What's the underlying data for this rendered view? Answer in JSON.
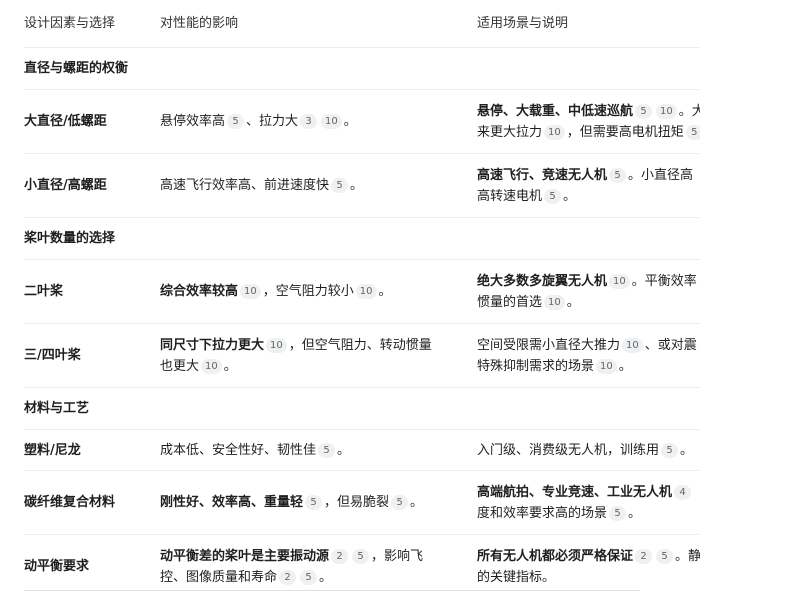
{
  "header": {
    "col1": "设计因素与选择",
    "col2": "对性能的影响",
    "col3": "适用场景与说明"
  },
  "sections": {
    "s1": "直径与螺距的权衡",
    "s2": "桨叶数量的选择",
    "s3": "材料与工艺"
  },
  "rows": {
    "r1": {
      "name": "大直径/低螺距",
      "impact": {
        "t1": "悬停效率高",
        "c1": "5",
        "t2": "、拉力大",
        "c2": "3",
        "c3": "10",
        "t3": "。"
      },
      "usage": {
        "t1": "悬停、大载重、中低速巡航",
        "c1": "5",
        "c2": "10",
        "t2": "。大",
        "t3": "来更大拉力",
        "c3": "10",
        "t4": "，但需要高电机扭矩",
        "c4": "5"
      }
    },
    "r2": {
      "name": "小直径/高螺距",
      "impact": {
        "t1": "高速飞行效率高、前进速度快",
        "c1": "5",
        "t2": "。"
      },
      "usage": {
        "t1": "高速飞行、竞速无人机",
        "c1": "5",
        "t2": "。小直径高",
        "t3": "高转速电机",
        "c2": "5",
        "t4": "。"
      }
    },
    "r3": {
      "name": "二叶桨",
      "impact": {
        "t1": "综合效率较高",
        "c1": "10",
        "t2": "，空气阻力较小",
        "c2": "10",
        "t3": "。"
      },
      "usage": {
        "t1": "绝大多数多旋翼无人机",
        "c1": "10",
        "t2": "。平衡效率",
        "t3": "惯量的首选",
        "c2": "10",
        "t4": "。"
      }
    },
    "r4": {
      "name": "三/四叶桨",
      "impact": {
        "t1": "同尺寸下拉力更大",
        "c1": "10",
        "t2": "，但空气阻力、转动惯量",
        "t3": "也更大",
        "c2": "10",
        "t4": "。"
      },
      "usage": {
        "t1": "空间受限需小直径大推力",
        "c1": "10",
        "t2": "、或对震",
        "t3": "特殊抑制需求的场景",
        "c2": "10",
        "t4": "。"
      }
    },
    "r5": {
      "name": "塑料/尼龙",
      "impact": {
        "t1": "成本低、安全性好、韧性佳",
        "c1": "5",
        "t2": "。"
      },
      "usage": {
        "t1": "入门级、消费级无人机，训练用",
        "c1": "5",
        "t2": "。"
      }
    },
    "r6": {
      "name": "碳纤维复合材料",
      "impact": {
        "t1": "刚性好、效率高、重量轻",
        "c1": "5",
        "t2": "，但易脆裂",
        "c2": "5",
        "t3": "。"
      },
      "usage": {
        "t1": "高端航拍、专业竞速、工业无人机",
        "c1": "4",
        "t2": "度和效率要求高的场景",
        "c2": "5",
        "t3": "。"
      }
    },
    "r7": {
      "name": "动平衡要求",
      "impact": {
        "t1": "动平衡差的桨叶是主要振动源",
        "c1": "2",
        "c2": "5",
        "t2": "，影响飞",
        "t3": "控、图像质量和寿命",
        "c3": "2",
        "c4": "5",
        "t4": "。"
      },
      "usage": {
        "t1": "所有无人机都必须严格保证",
        "c1": "2",
        "c2": "5",
        "t2": "。静",
        "t3": "的关键指标。"
      }
    }
  }
}
